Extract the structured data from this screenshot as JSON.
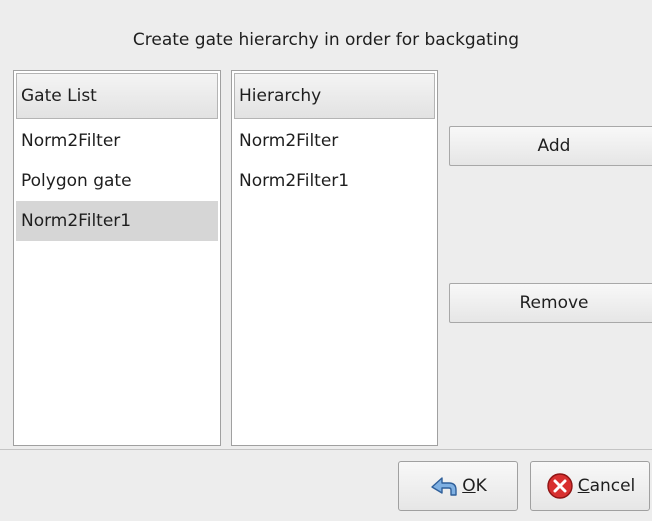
{
  "dialog": {
    "heading": "Create gate hierarchy in order for backgating"
  },
  "gate_list": {
    "header": "Gate List",
    "items": [
      "Norm2Filter",
      "Polygon gate",
      "Norm2Filter1"
    ],
    "selected_index": 2
  },
  "hierarchy": {
    "header": "Hierarchy",
    "items": [
      "Norm2Filter",
      "Norm2Filter1"
    ]
  },
  "actions": {
    "add_label": "Add",
    "remove_label": "Remove"
  },
  "footer": {
    "ok_mnemonic": "O",
    "ok_rest": "K",
    "ok_icon": "back-arrow-icon",
    "cancel_mnemonic": "C",
    "cancel_rest": "ancel",
    "cancel_icon": "cancel-x-icon"
  }
}
